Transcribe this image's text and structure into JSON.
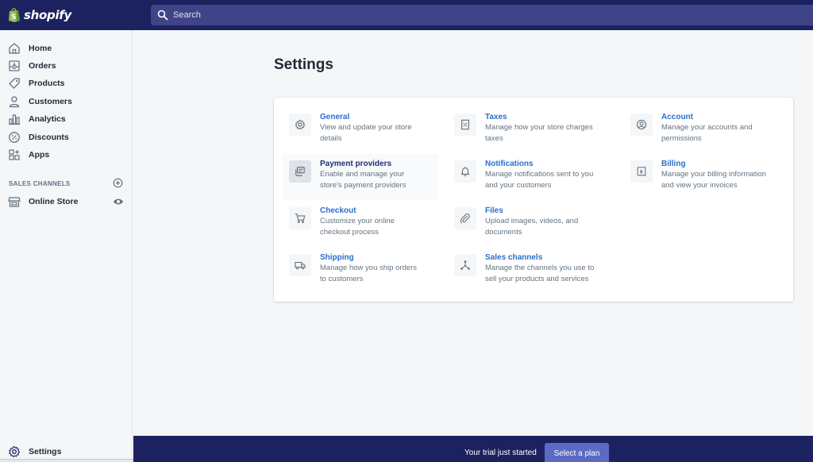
{
  "app": {
    "logo_text": "shopify"
  },
  "search": {
    "placeholder": "Search"
  },
  "sidebar": {
    "items": [
      {
        "label": "Home",
        "icon": "home-icon"
      },
      {
        "label": "Orders",
        "icon": "orders-icon"
      },
      {
        "label": "Products",
        "icon": "tag-icon"
      },
      {
        "label": "Customers",
        "icon": "person-icon"
      },
      {
        "label": "Analytics",
        "icon": "bar-chart-icon"
      },
      {
        "label": "Discounts",
        "icon": "discount-icon"
      },
      {
        "label": "Apps",
        "icon": "apps-icon"
      }
    ],
    "sales_channels_title": "SALES CHANNELS",
    "online_store": "Online Store",
    "settings": "Settings"
  },
  "main": {
    "title": "Settings",
    "tiles": [
      {
        "title": "General",
        "desc1": "View and update your store",
        "desc2": "details",
        "icon": "gear-icon"
      },
      {
        "title": "Taxes",
        "desc1": "Manage how your store charges",
        "desc2": "taxes",
        "icon": "tax-receipt-icon"
      },
      {
        "title": "Account",
        "desc1": "Manage your accounts and",
        "desc2": "permissions",
        "icon": "account-icon"
      },
      {
        "title": "Payment providers",
        "desc1": "Enable and manage your",
        "desc2": "store's payment providers",
        "icon": "payment-icon"
      },
      {
        "title": "Notifications",
        "desc1": "Manage notifications sent to you",
        "desc2": "and your customers",
        "icon": "bell-icon"
      },
      {
        "title": "Billing",
        "desc1": "Manage your billing information",
        "desc2": "and view your invoices",
        "icon": "invoice-icon"
      },
      {
        "title": "Checkout",
        "desc1": "Customize your online",
        "desc2": "checkout process",
        "icon": "cart-icon"
      },
      {
        "title": "Files",
        "desc1": "Upload images, videos, and",
        "desc2": "documents",
        "icon": "paperclip-icon"
      },
      {
        "title": "Shipping",
        "desc1": "Manage how you ship orders",
        "desc2": "to customers",
        "icon": "truck-icon"
      },
      {
        "title": "Sales channels",
        "desc1": "Manage the channels you use to",
        "desc2": "sell your products and services",
        "icon": "channels-icon"
      }
    ]
  },
  "trial": {
    "text": "Your trial just started",
    "button": "Select a plan"
  },
  "colors": {
    "topbar": "#1c2260",
    "search": "#3f4489",
    "link": "#2c6ecb",
    "button": "#5c6ac4",
    "logo_green": "#95bf47"
  }
}
